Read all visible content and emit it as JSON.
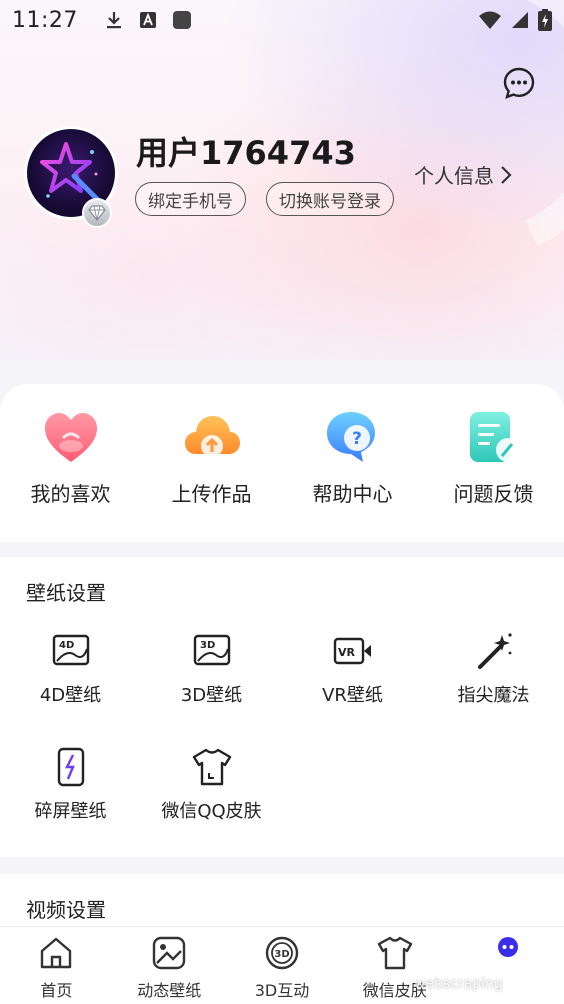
{
  "status_bar": {
    "time": "11:27"
  },
  "profile": {
    "username": "用户1764743",
    "info_link": "个人信息",
    "bind_phone": "绑定手机号",
    "switch_account": "切换账号登录"
  },
  "quick_actions": [
    {
      "label": "我的喜欢",
      "icon": "heart-icon"
    },
    {
      "label": "上传作品",
      "icon": "cloud-upload-icon"
    },
    {
      "label": "帮助中心",
      "icon": "help-bubble-icon"
    },
    {
      "label": "问题反馈",
      "icon": "feedback-note-icon"
    }
  ],
  "wallpaper_settings": {
    "title": "壁纸设置",
    "items": [
      {
        "label": "4D壁纸",
        "icon": "4d-wallpaper-icon"
      },
      {
        "label": "3D壁纸",
        "icon": "3d-wallpaper-icon"
      },
      {
        "label": "VR壁纸",
        "icon": "vr-camera-icon"
      },
      {
        "label": "指尖魔法",
        "icon": "magic-wand-icon"
      },
      {
        "label": "碎屏壁纸",
        "icon": "broken-screen-icon"
      },
      {
        "label": "微信QQ皮肤",
        "icon": "tshirt-icon"
      }
    ]
  },
  "video_settings": {
    "title": "视频设置"
  },
  "bottom_nav": [
    {
      "label": "首页",
      "icon": "home-icon"
    },
    {
      "label": "动态壁纸",
      "icon": "dynamic-wallpaper-icon"
    },
    {
      "label": "3D互动",
      "icon": "3d-interact-icon"
    },
    {
      "label": "微信皮肤",
      "icon": "wechat-skin-icon"
    },
    {
      "label": "",
      "icon": "profile-robot-icon"
    }
  ],
  "watermark": "webscraping",
  "colors": {
    "accent": "#4a3cf0",
    "card_bg": "#ffffff",
    "page_bg": "#f4f4f9"
  }
}
